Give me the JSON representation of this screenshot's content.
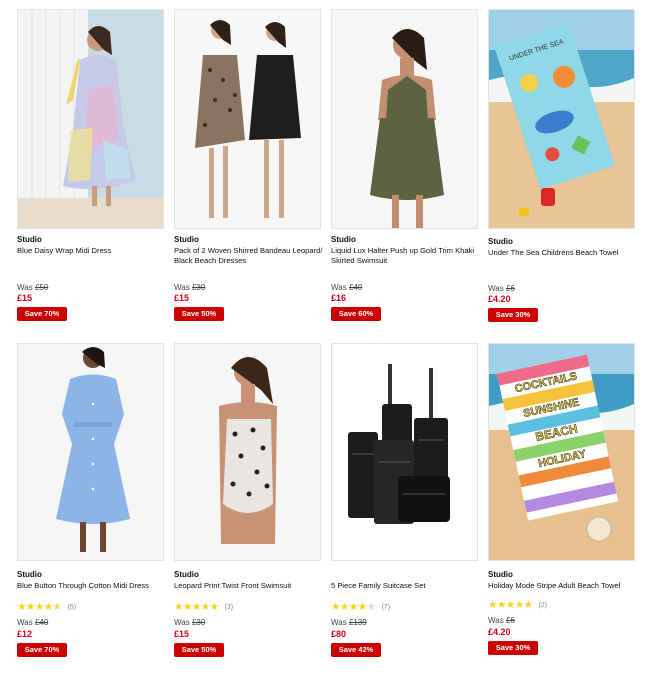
{
  "products": [
    {
      "brand": "Studio",
      "title": "Blue Daisy Wrap Midi Dress",
      "was_label": "Was",
      "was_price": "£50",
      "price": "£15",
      "save": "Save 70%"
    },
    {
      "brand": "Studio",
      "title": "Pack of 2 Woven Shirred Bandeau Leopard/ Black Beach Dresses",
      "was_label": "Was",
      "was_price": "£30",
      "price": "£15",
      "save": "Save 50%"
    },
    {
      "brand": "Studio",
      "title": "Liquid Lux Halter Push up Gold Trim Khaki Skirted Swimsuit",
      "was_label": "Was",
      "was_price": "£40",
      "price": "£16",
      "save": "Save 60%"
    },
    {
      "brand": "Studio",
      "title": "Under The Sea Childrens Beach Towel",
      "was_label": "Was",
      "was_price": "£6",
      "price": "£4.20",
      "save": "Save 30%",
      "towel_text": "UNDER THE SEA"
    },
    {
      "brand": "Studio",
      "title": "Blue Button Through Cotton Midi Dress",
      "stars": "★★★★★",
      "rating": 4.5,
      "review_count": "(5)",
      "was_label": "Was",
      "was_price": "£40",
      "price": "£12",
      "save": "Save 70%"
    },
    {
      "brand": "Studio",
      "title": "Leopard Print Twist Front Swimsuit",
      "stars": "★★★★★",
      "rating": 5,
      "review_count": "(3)",
      "was_label": "Was",
      "was_price": "£30",
      "price": "£15",
      "save": "Save 50%"
    },
    {
      "brand": "",
      "title": "5 Piece Family Suitcase Set",
      "stars": "★★★★★",
      "rating": 4,
      "review_count": "(7)",
      "was_label": "Was",
      "was_price": "£139",
      "price": "£80",
      "save": "Save 42%"
    },
    {
      "brand": "Studio",
      "title": "Holiday Mode Stripe Adult Beach Towel",
      "stars": "★★★★★",
      "rating": 5,
      "review_count": "(2)",
      "was_label": "Was",
      "was_price": "£6",
      "price": "£4.20",
      "save": "Save 30%",
      "towel_words": [
        "COCKTAILS",
        "SUNSHINE",
        "BEACH",
        "HOLIDAY"
      ]
    }
  ],
  "colors": {
    "sale_red": "#d0021b",
    "badge_red": "#cc0000",
    "star_yellow": "#f5d30f"
  }
}
